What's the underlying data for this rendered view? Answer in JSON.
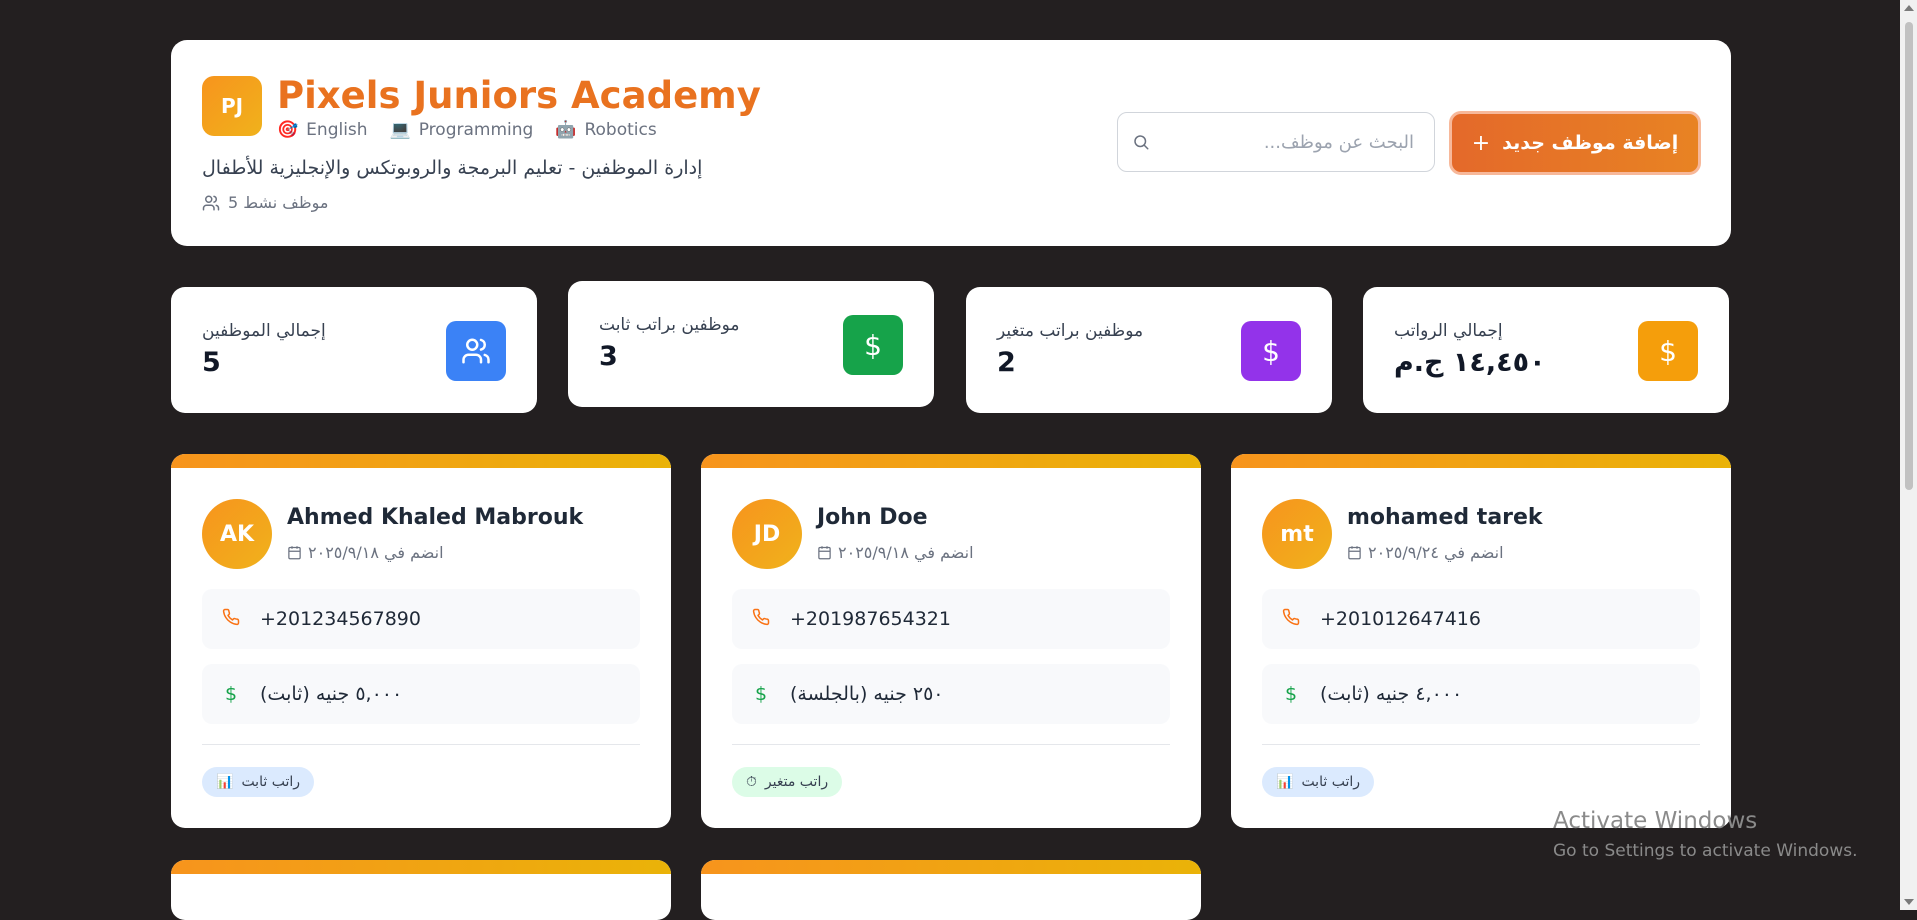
{
  "header": {
    "logo_initials": "PJ",
    "title": "Pixels Juniors Academy",
    "tags": [
      {
        "icon": "🎯",
        "label": "English"
      },
      {
        "icon": "💻",
        "label": "Programming"
      },
      {
        "icon": "🤖",
        "label": "Robotics"
      }
    ],
    "subtitle": "إدارة الموظفين - تعليم البرمجة والروبوتكس والإنجليزية للأطفال",
    "active_count": "موظف نشط 5",
    "search_placeholder": "البحث عن موظف...",
    "add_button_label": "إضافة موظف جديد"
  },
  "stats": [
    {
      "label": "إجمالي الموظفين",
      "value": "5",
      "icon": "users-icon",
      "color": "#3b82f6"
    },
    {
      "label": "موظفين براتب ثابت",
      "value": "3",
      "icon": "dollar-icon",
      "color": "#16a34a"
    },
    {
      "label": "موظفين براتب متغير",
      "value": "2",
      "icon": "dollar-icon",
      "color": "#9333ea"
    },
    {
      "label": "إجمالي الرواتب",
      "value": "١٤,٤٥٠ ج.م",
      "icon": "dollar-icon",
      "color": "#f59e0b"
    }
  ],
  "employees": [
    {
      "initials": "AK",
      "name": "Ahmed Khaled Mabrouk",
      "joined": "انضم في ٢٠٢٥/٩/١٨",
      "phone": "+201234567890",
      "salary": "٥,٠٠٠ جنيه (ثابت)",
      "badge": "راتب ثابت",
      "badge_icon": "📊"
    },
    {
      "initials": "JD",
      "name": "John Doe",
      "joined": "انضم في ٢٠٢٥/٩/١٨",
      "phone": "+201987654321",
      "salary": "٢٥٠ جنيه (بالجلسة)",
      "badge": "راتب متغير",
      "badge_icon": "⏱"
    },
    {
      "initials": "mt",
      "name": "mohamed tarek",
      "joined": "انضم في ٢٠٢٥/٩/٢٤",
      "phone": "+201012647416",
      "salary": "٤,٠٠٠ جنيه (ثابت)",
      "badge": "راتب ثابت",
      "badge_icon": "📊"
    }
  ],
  "watermark": {
    "line1": "Activate Windows",
    "line2": "Go to Settings to activate Windows."
  },
  "colors": {
    "accent": "#e9721f",
    "background": "#231f20"
  }
}
